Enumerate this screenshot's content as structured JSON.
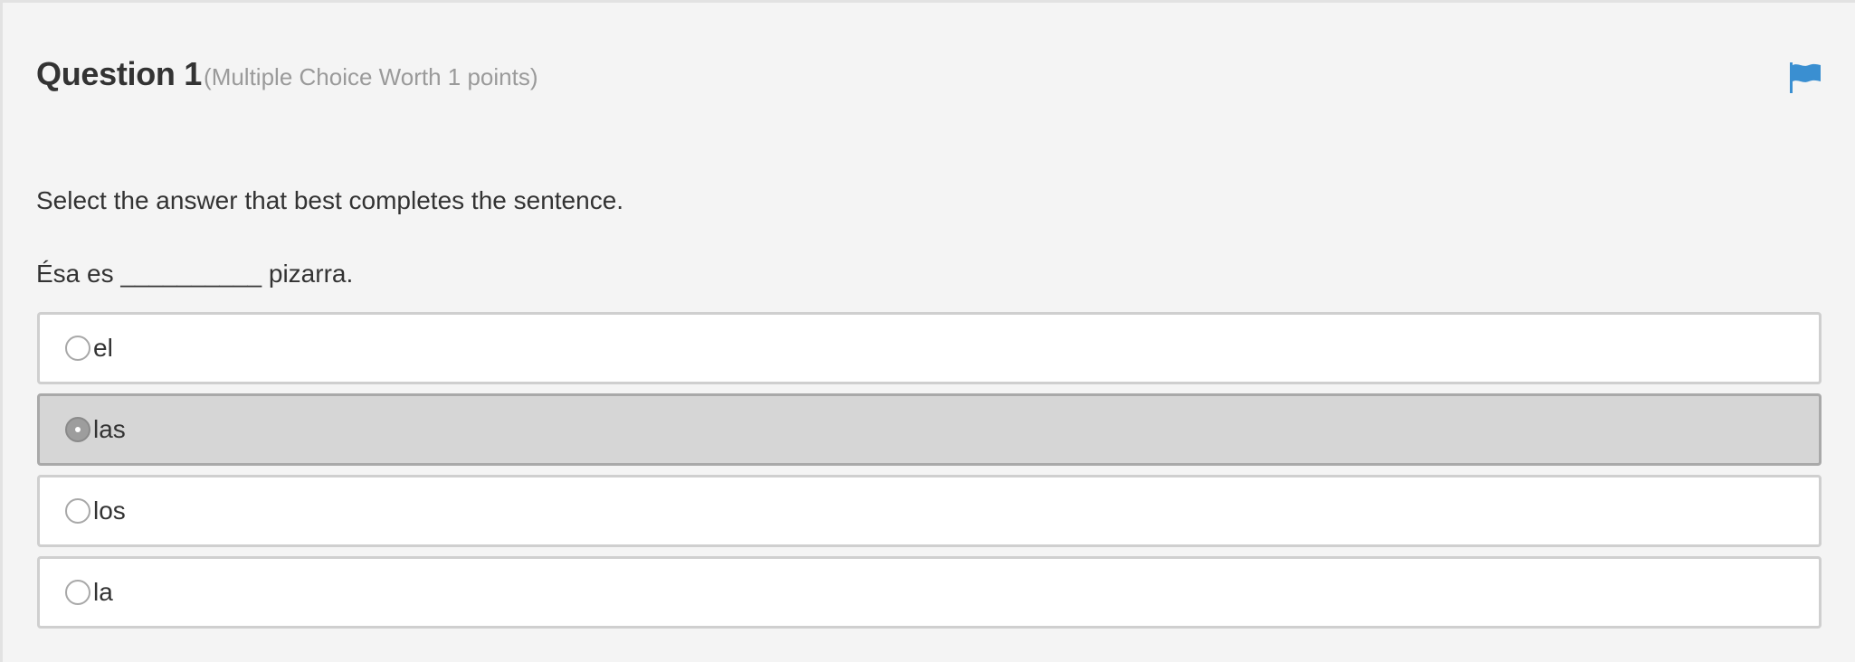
{
  "question": {
    "title": "Question 1",
    "meta": "(Multiple Choice Worth 1 points)",
    "flag_icon": "flag-icon",
    "flag_color": "#3a8fd1"
  },
  "instruction": "Select the answer that best completes the sentence.",
  "sentence": "Ésa es __________ pizarra.",
  "options": [
    {
      "label": "el",
      "selected": false
    },
    {
      "label": "las",
      "selected": true
    },
    {
      "label": "los",
      "selected": false
    },
    {
      "label": "la",
      "selected": false
    }
  ],
  "colors": {
    "background": "#f4f4f4",
    "selected_option": "#d6d6d6",
    "option": "#ffffff",
    "meta_text": "#9a9a9a"
  }
}
